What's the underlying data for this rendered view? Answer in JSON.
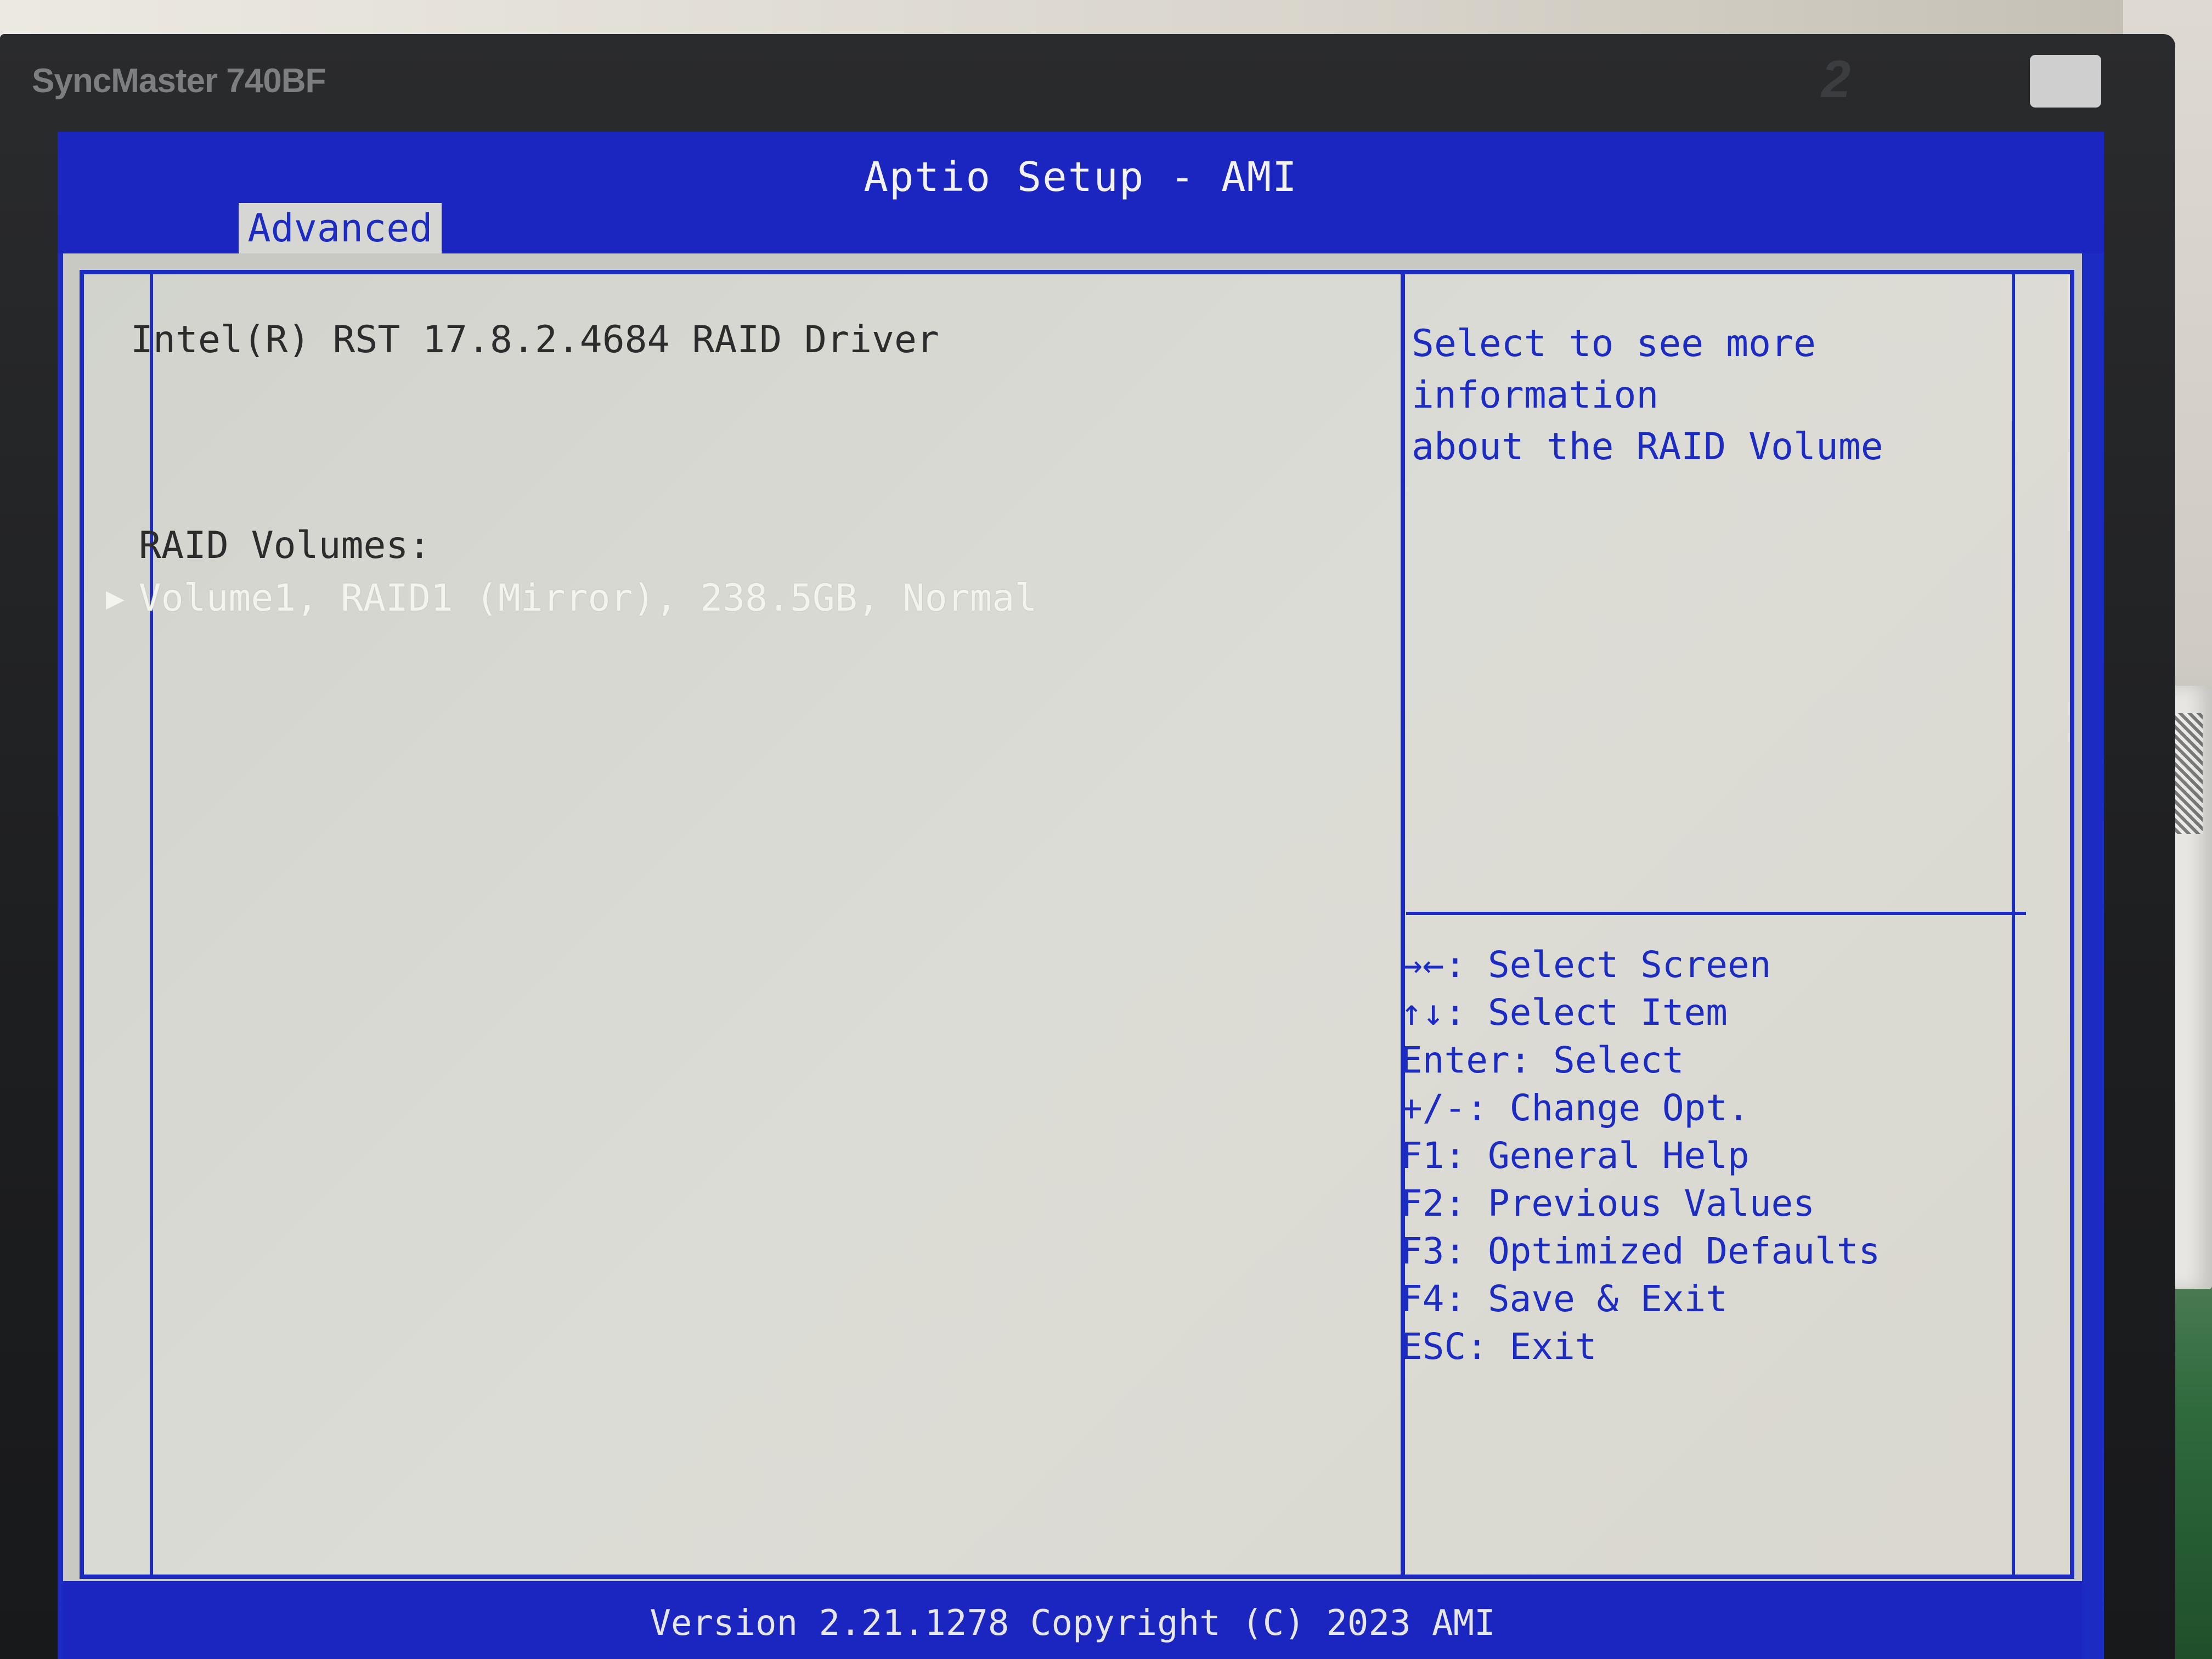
{
  "monitor": {
    "brand": "SyncMaster 740BF"
  },
  "bios": {
    "title": "Aptio Setup - AMI",
    "tab": "Advanced",
    "driver": "Intel(R) RST 17.8.2.4684 RAID Driver",
    "raid_label": "RAID Volumes:",
    "volume": "Volume1, RAID1 (Mirror), 238.5GB, Normal",
    "help": {
      "line1": "Select to see more information",
      "line2": "about the RAID Volume"
    },
    "keys": [
      "→←: Select Screen",
      "↑↓: Select Item",
      "Enter: Select",
      "+/-: Change Opt.",
      "F1: General Help",
      "F2: Previous Values",
      "F3: Optimized Defaults",
      "F4: Save & Exit",
      "ESC: Exit"
    ],
    "footer": "Version 2.21.1278 Copyright (C) 2023 AMI"
  },
  "colors": {
    "bios_blue": "#1c2bc2",
    "bios_gray": "#d6d6d2",
    "highlight_text": "#f4f4ef"
  },
  "icons": {
    "selected_item": "triangle-right-icon"
  }
}
